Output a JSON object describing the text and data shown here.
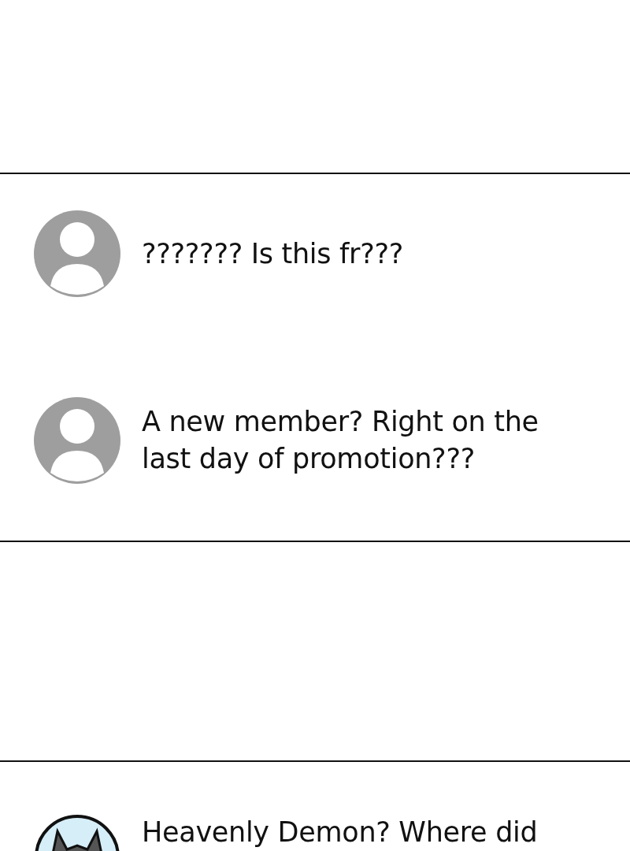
{
  "threads": [
    {
      "kind": "chat",
      "messages": [
        {
          "kind": "default",
          "text": "??????? Is this fr???"
        },
        {
          "kind": "default",
          "text": "A new member? Right on the last day of promotion???"
        }
      ]
    },
    {
      "kind": "blank"
    },
    {
      "kind": "chat",
      "messages": [
        {
          "kind": "illustrated",
          "text": "Heavenly Demon? Where did"
        }
      ]
    }
  ]
}
